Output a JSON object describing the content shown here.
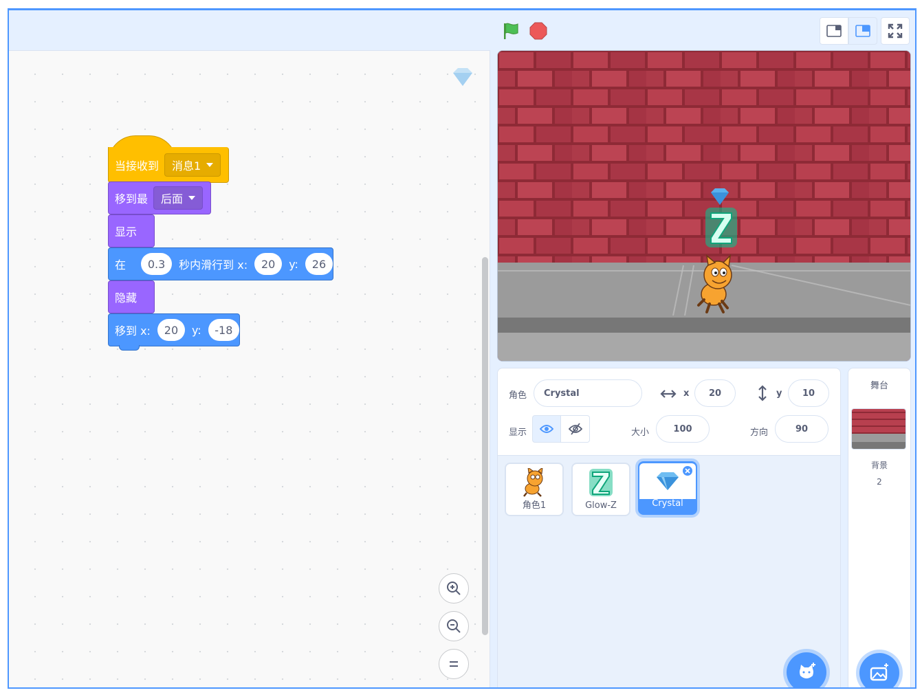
{
  "code": {
    "event_block": {
      "label": "当接收到",
      "dropdown": "消息1"
    },
    "goto_layer": {
      "label": "移到最",
      "dropdown": "后面"
    },
    "show": {
      "label": "显示"
    },
    "glide": {
      "prefix": "在",
      "secs": "0.3",
      "mid": "秒内滑行到 x:",
      "x": "20",
      "ylabel": "y:",
      "y": "26"
    },
    "hide": {
      "label": "隐藏"
    },
    "goto_xy": {
      "label": "移到 x:",
      "x": "20",
      "ylabel": "y:",
      "y": "-18"
    }
  },
  "sprite_info": {
    "sprite_label": "角色",
    "sprite_name": "Crystal",
    "x_label": "x",
    "x_value": "20",
    "y_label": "y",
    "y_value": "10",
    "show_label": "显示",
    "size_label": "大小",
    "size_value": "100",
    "direction_label": "方向",
    "direction_value": "90"
  },
  "sprites": [
    {
      "name": "角色1",
      "icon": "cat-sprite-icon"
    },
    {
      "name": "Glow-Z",
      "icon": "glow-z-sprite-icon"
    },
    {
      "name": "Crystal",
      "icon": "crystal-sprite-icon",
      "selected": true
    }
  ],
  "stage_panel": {
    "title": "舞台",
    "backdrop_label": "背景",
    "backdrop_count": "2"
  },
  "colors": {
    "accent": "#4c97ff",
    "events": "#ffbf00",
    "looks": "#9966ff",
    "motion": "#4c97ff",
    "green_flag": "#4cbf56",
    "stop": "#ec5959"
  }
}
